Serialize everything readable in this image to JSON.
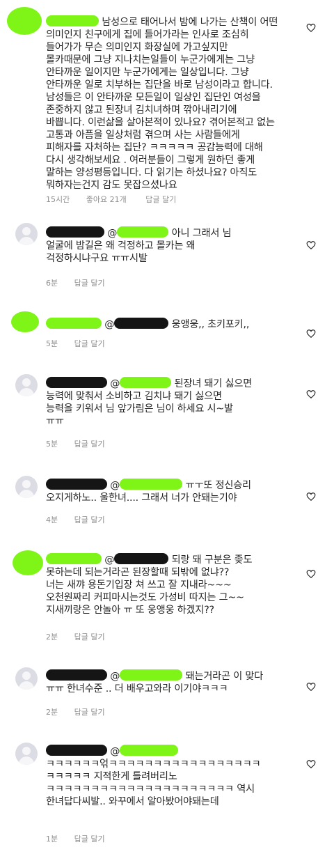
{
  "comments": [
    {
      "avatar": "green",
      "lines": [
        "남성으로 태어나서 밤에 나가는 산책이 어떤",
        "의미인지 친구에게 집에 들어가라는 인사로 조심히",
        "들어가가 무슨 의미인지 화장실에 가고싶지만",
        "몰카때문에 그냥 지나치는일들이 누군가에게는 그냥",
        "안타까운 일이지만 누군가에게는 일상입니다. 그냥",
        "안타까운 일로 치부하는 집단을 바로 남성이라고 합니다.",
        "남성들은 이 안타까운 모든일이 일상인 집단인 여성을",
        "존중하지 않고 된장녀 김치녀하며 깎아내리기에",
        "바쁩니다. 이런삶을 살아본적이 있나요? 겪어본적고 없는",
        "고통과 아픔을 일상처럼 겪으며 사는 사람들에게",
        "피해자를 자처하는 집단? ㅋㅋㅋㅋㅋ 공감능력에 대해",
        "다시 생각해보세요 . 여러분들이 그렇게 원하던 좋게",
        "말하는 양성평등입니다. 다 읽기는 하셨나요? 아직도",
        "뭐하자는건지 감도 못잡으셨나요"
      ],
      "time": "15시간",
      "likes": "좋아요 21개",
      "reply": "답글 달기"
    },
    {
      "avatar": "gray",
      "lines": [
        "아니 그래서 님",
        "얼굴에 밤길은 왜 걱정하고 몰카는 왜",
        "걱정하시냐구요 ㅠㅠ시발"
      ],
      "time": "6분",
      "reply": "답글 달기"
    },
    {
      "avatar": "green",
      "lines": [
        "웅앵웅,, 초키포키,,"
      ],
      "time": "5분",
      "reply": "답글 달기"
    },
    {
      "avatar": "gray",
      "lines": [
        "된장녀 돼기 싫으면",
        "능력에 맞춰서 소비하고 김치냐 돼기 싫으면",
        "능력을 키워서 님 앞가림은 님이 하세요 시~발",
        "ㅠㅠ"
      ],
      "time": "5분",
      "reply": "답글 달기"
    },
    {
      "avatar": "gray",
      "lines": [
        "ㅠㅜ또 정신승리",
        "오지게하노.. 울한녀.... 그래서 너가 안돼는기야"
      ],
      "time": "4분",
      "reply": "답글 달기"
    },
    {
      "avatar": "green",
      "lines": [
        "되랑 돼 구분은 좆도",
        "못하는데 되는거라곤 된장할때 되밖에 없냐??",
        "너는 새꺄 용돈기입장 쳐 쓰고 잘 지내라~~~",
        "오천원짜리 커피마시는것도 가성비 따지는 그~~",
        "지새끼랑은 안놀아 ㅠ 또 웅앵웅 하겠지??"
      ],
      "time": "2분",
      "reply": "답글 달기"
    },
    {
      "avatar": "gray",
      "lines": [
        "돼는거라곤 이 맞다",
        "ㅠㅠ 한녀수준 .. 더 배우고와라 이기야ㅋㅋㅋ"
      ],
      "time": "2분",
      "reply": "답글 달기"
    },
    {
      "avatar": "gray",
      "lines": [
        "ㅋㅋㅋㅋㅋㅋ얶ㅋㅋㅋㅋㅋㅋㅋㅋㅋㅋㅋㅋㅋㅋㅋㅋㅋ",
        "ㅋㅋㅋㅋㅋ 지적한게 틀려버리노",
        "ㅋㅋㅋㅋㅋㅋㅋㅋㅋㅋㅋㅋㅋㅋㅋㅋㅋㅋㅋㅋㅋ 역시",
        "한녀답다씨발.. 와꾸에서 알아봤어야돼는데"
      ],
      "time": "1분",
      "reply": "답글 달기"
    }
  ]
}
